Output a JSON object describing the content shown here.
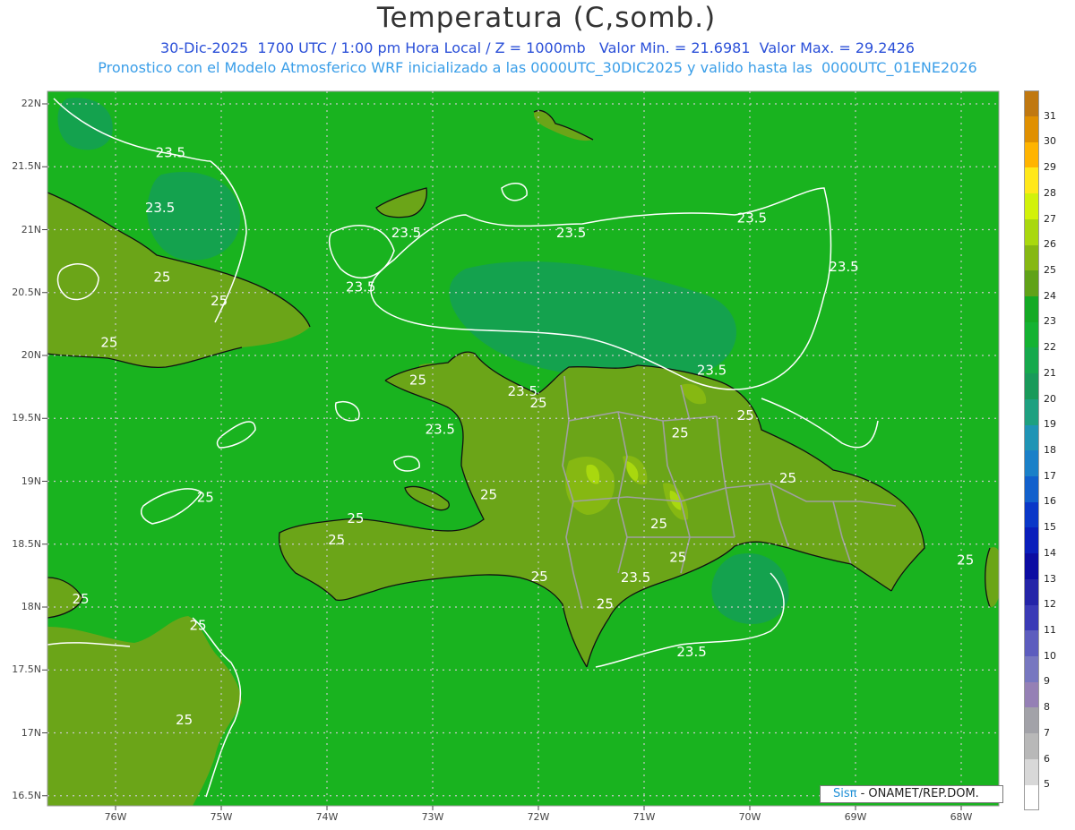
{
  "header": {
    "title": "Temperatura (C,somb.)",
    "line1": "30-Dic-2025  1700 UTC / 1:00 pm Hora Local / Z = 1000mb   Valor Min. = 21.6981  Valor Max. = 29.2426",
    "line2": "Pronostico con el Modelo Atmosferico WRF inicializado a las 0000UTC_30DIC2025 y valido hasta las  0000UTC_01ENE2026"
  },
  "axes": {
    "lat_labels": [
      "22N",
      "21.5N",
      "21N",
      "20.5N",
      "20N",
      "19.5N",
      "19N",
      "18.5N",
      "18N",
      "17.5N",
      "17N",
      "16.5N"
    ],
    "lon_labels": [
      "76W",
      "75W",
      "74W",
      "73W",
      "72W",
      "71W",
      "70W",
      "69W",
      "68W"
    ]
  },
  "contour_labels": [
    {
      "text": "23.5",
      "lon": -75.48,
      "lat": 21.61
    },
    {
      "text": "23.5",
      "lon": -75.58,
      "lat": 21.17
    },
    {
      "text": "23.5",
      "lon": -73.25,
      "lat": 20.97
    },
    {
      "text": "23.5",
      "lon": -73.68,
      "lat": 20.54
    },
    {
      "text": "23.5",
      "lon": -71.69,
      "lat": 20.97
    },
    {
      "text": "23.5",
      "lon": -69.98,
      "lat": 21.09
    },
    {
      "text": "23.5",
      "lon": -69.11,
      "lat": 20.7
    },
    {
      "text": "23.5",
      "lon": -70.36,
      "lat": 19.88
    },
    {
      "text": "23.5",
      "lon": -72.15,
      "lat": 19.71
    },
    {
      "text": "23.5",
      "lon": -72.93,
      "lat": 19.41
    },
    {
      "text": "23.5",
      "lon": -71.08,
      "lat": 18.23
    },
    {
      "text": "23.5",
      "lon": -70.55,
      "lat": 17.64
    },
    {
      "text": "25",
      "lon": -75.56,
      "lat": 20.62
    },
    {
      "text": "25",
      "lon": -75.02,
      "lat": 20.43
    },
    {
      "text": "25",
      "lon": -76.06,
      "lat": 20.1
    },
    {
      "text": "25",
      "lon": -73.14,
      "lat": 19.8
    },
    {
      "text": "25",
      "lon": -72.0,
      "lat": 19.62
    },
    {
      "text": "25",
      "lon": -70.04,
      "lat": 19.52
    },
    {
      "text": "25",
      "lon": -70.66,
      "lat": 19.38
    },
    {
      "text": "25",
      "lon": -69.64,
      "lat": 19.02
    },
    {
      "text": "25",
      "lon": -72.47,
      "lat": 18.89
    },
    {
      "text": "25",
      "lon": -75.15,
      "lat": 18.87
    },
    {
      "text": "25",
      "lon": -73.73,
      "lat": 18.7
    },
    {
      "text": "25",
      "lon": -73.91,
      "lat": 18.53
    },
    {
      "text": "25",
      "lon": -70.86,
      "lat": 18.66
    },
    {
      "text": "25",
      "lon": -71.99,
      "lat": 18.24
    },
    {
      "text": "25",
      "lon": -70.68,
      "lat": 18.39
    },
    {
      "text": "25",
      "lon": -71.37,
      "lat": 18.02
    },
    {
      "text": "25",
      "lon": -67.96,
      "lat": 18.37
    },
    {
      "text": "25",
      "lon": -76.33,
      "lat": 18.06
    },
    {
      "text": "25",
      "lon": -75.22,
      "lat": 17.85
    },
    {
      "text": "25",
      "lon": -75.35,
      "lat": 17.1
    }
  ],
  "colorbar": {
    "labels": [
      "5",
      "6",
      "7",
      "8",
      "9",
      "10",
      "11",
      "12",
      "13",
      "14",
      "15",
      "16",
      "17",
      "18",
      "19",
      "20",
      "21",
      "22",
      "23",
      "24",
      "25",
      "26",
      "27",
      "28",
      "29",
      "30",
      "31"
    ],
    "colors": [
      "#ffffff",
      "#d8d8d8",
      "#b8b8b8",
      "#a2a2a8",
      "#9580b5",
      "#7777c0",
      "#5c5cbe",
      "#3a3ab6",
      "#2424a8",
      "#0c0ca2",
      "#0a1ebb",
      "#0a37c8",
      "#1160cc",
      "#1a80c8",
      "#1f94b5",
      "#1ea080",
      "#199a5a",
      "#16a94c",
      "#14b232",
      "#14aa24",
      "#60a218",
      "#86b812",
      "#a9d80e",
      "#d2f20a",
      "#ffe81a",
      "#ffb400",
      "#e09000",
      "#c07810"
    ]
  },
  "legend_colors": {
    "ocean": "#19b31f",
    "island": "#6ba518",
    "warm": "#a9d80e",
    "cool": "#14a24e"
  },
  "credit": {
    "brand": "Sisπ",
    "org": "- ONAMET/REP.DOM."
  }
}
